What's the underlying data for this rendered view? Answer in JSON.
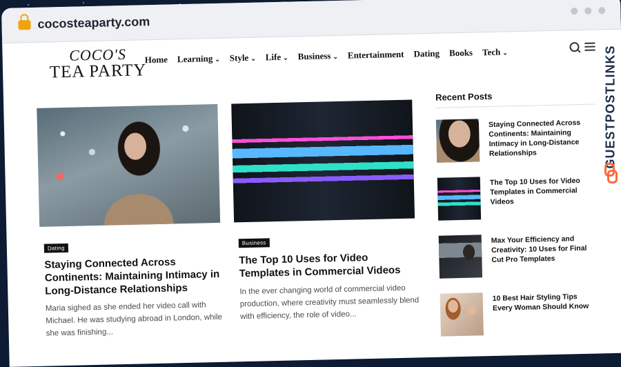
{
  "browser": {
    "url": "cocosteaparty.com"
  },
  "logo": {
    "line1": "COCO'S",
    "line2": "TEA PARTY"
  },
  "nav": [
    {
      "label": "Home",
      "dropdown": false
    },
    {
      "label": "Learning",
      "dropdown": true
    },
    {
      "label": "Style",
      "dropdown": true
    },
    {
      "label": "Life",
      "dropdown": true
    },
    {
      "label": "Business",
      "dropdown": true
    },
    {
      "label": "Entertainment",
      "dropdown": false
    },
    {
      "label": "Dating",
      "dropdown": false
    },
    {
      "label": "Books",
      "dropdown": false
    },
    {
      "label": "Tech",
      "dropdown": true
    }
  ],
  "icons": {
    "search": "search-icon",
    "menu": "hamburger-menu-icon",
    "lock": "lock-icon"
  },
  "featured": [
    {
      "category": "Dating",
      "title": "Staying Connected Across Continents: Maintaining Intimacy in Long-Distance Relationships",
      "excerpt": "Maria sighed as she ended her video call with Michael. He was studying abroad in London, while she was finishing..."
    },
    {
      "category": "Business",
      "title": "The Top 10 Uses for Video Templates in Commercial Videos",
      "excerpt": "In the ever changing world of commercial video production, where creativity must seamlessly blend with efficiency, the role of video..."
    }
  ],
  "recent": {
    "heading": "Recent Posts",
    "items": [
      {
        "title": "Staying Connected Across Continents: Maintaining Intimacy in Long-Distance Relationships"
      },
      {
        "title": "The Top 10 Uses for Video Templates in Commercial Videos"
      },
      {
        "title": "Max Your Efficiency and Creativity: 10 Uses for Final Cut Pro Templates"
      },
      {
        "title": "10 Best Hair Styling Tips Every Woman Should Know"
      }
    ]
  },
  "watermark": {
    "text": "GUESTPOSTLINKS"
  },
  "colors": {
    "lock": "#f2a20a",
    "background": "#0d1b33",
    "watermark": "#1b2d4a",
    "watermark_icon": "#ff6a3d"
  }
}
